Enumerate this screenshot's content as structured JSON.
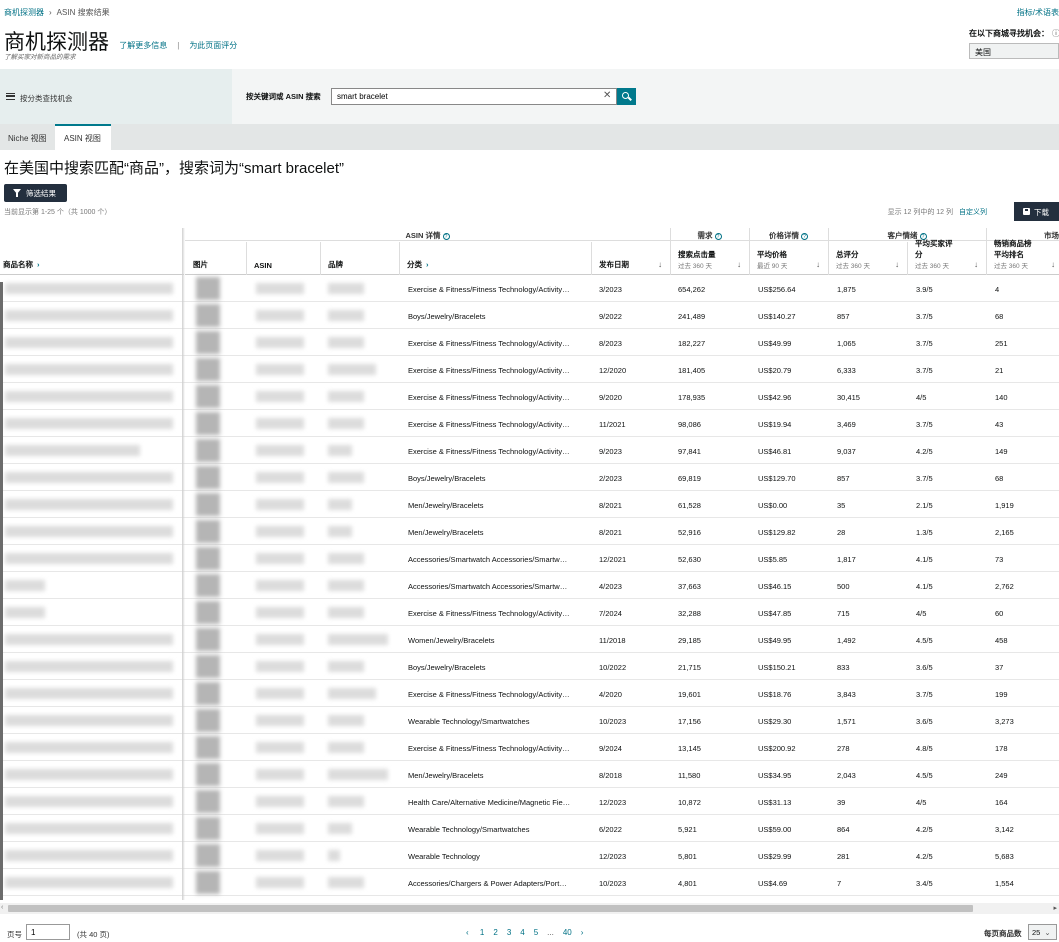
{
  "breadcrumb": {
    "root": "商机探测器",
    "current": "ASIN 搜索结果"
  },
  "top_right_link": "指标/术语表",
  "header": {
    "title": "商机探测器",
    "learn_more": "了解更多信息",
    "rate_page": "为此页面评分",
    "subtitle": "了解买家对新商品的需求"
  },
  "market": {
    "label": "在以下商城寻找机会：",
    "help_icon": "help-icon",
    "value": "美国"
  },
  "search": {
    "left_label": "按分类查找机会",
    "keyword_label": "按关键词或 ASIN 搜索",
    "value": "smart bracelet",
    "clear_icon": "close-icon",
    "button_icon": "search-icon"
  },
  "tabs": [
    {
      "label": "Niche 视图"
    },
    {
      "label": "ASIN 视图"
    }
  ],
  "result_heading": "在美国中搜索匹配“商品”，搜索词为“smart bracelet”",
  "filter_button": "筛选结果",
  "showing": "当前显示第 1-25 个（共 1000 个）",
  "columns_info": "显示 12 列中的 12 列",
  "customize_columns": "自定义列",
  "download_button": "下载",
  "table": {
    "groups": {
      "asin_details": "ASIN 详情",
      "demand": "需求",
      "price": "价格详情",
      "customer": "客户情绪",
      "market": "市场"
    },
    "columns": {
      "product_name": "商品名称",
      "image": "图片",
      "asin": "ASIN",
      "brand": "品牌",
      "category": "分类",
      "launch_date": "发布日期",
      "search_clicks": "搜索点击量",
      "search_clicks_sub": "过去 360 天",
      "avg_price": "平均价格",
      "avg_price_sub": "最近 90 天",
      "total_ratings": "总评分",
      "total_ratings_sub": "过去 360 天",
      "avg_rating_l1": "平均买家评",
      "avg_rating_l2": "分",
      "avg_rating_sub": "过去 360 天",
      "bsr_l1": "畅销商品榜",
      "bsr_l2": "平均排名",
      "bsr_sub": "过去 360 天"
    },
    "rows": [
      {
        "category": "Exercise & Fitness/Fitness Technology/Activity…",
        "date": "3/2023",
        "clicks": "654,262",
        "price": "US$256.64",
        "ratings": "1,875",
        "rating": "3.9/5",
        "bsr": "4"
      },
      {
        "category": "Boys/Jewelry/Bracelets",
        "date": "9/2022",
        "clicks": "241,489",
        "price": "US$140.27",
        "ratings": "857",
        "rating": "3.7/5",
        "bsr": "68"
      },
      {
        "category": "Exercise & Fitness/Fitness Technology/Activity…",
        "date": "8/2023",
        "clicks": "182,227",
        "price": "US$49.99",
        "ratings": "1,065",
        "rating": "3.7/5",
        "bsr": "251"
      },
      {
        "category": "Exercise & Fitness/Fitness Technology/Activity…",
        "date": "12/2020",
        "clicks": "181,405",
        "price": "US$20.79",
        "ratings": "6,333",
        "rating": "3.7/5",
        "bsr": "21"
      },
      {
        "category": "Exercise & Fitness/Fitness Technology/Activity…",
        "date": "9/2020",
        "clicks": "178,935",
        "price": "US$42.96",
        "ratings": "30,415",
        "rating": "4/5",
        "bsr": "140"
      },
      {
        "category": "Exercise & Fitness/Fitness Technology/Activity…",
        "date": "11/2021",
        "clicks": "98,086",
        "price": "US$19.94",
        "ratings": "3,469",
        "rating": "3.7/5",
        "bsr": "43"
      },
      {
        "category": "Exercise & Fitness/Fitness Technology/Activity…",
        "date": "9/2023",
        "clicks": "97,841",
        "price": "US$46.81",
        "ratings": "9,037",
        "rating": "4.2/5",
        "bsr": "149"
      },
      {
        "category": "Boys/Jewelry/Bracelets",
        "date": "2/2023",
        "clicks": "69,819",
        "price": "US$129.70",
        "ratings": "857",
        "rating": "3.7/5",
        "bsr": "68"
      },
      {
        "category": "Men/Jewelry/Bracelets",
        "date": "8/2021",
        "clicks": "61,528",
        "price": "US$0.00",
        "ratings": "35",
        "rating": "2.1/5",
        "bsr": "1,919"
      },
      {
        "category": "Men/Jewelry/Bracelets",
        "date": "8/2021",
        "clicks": "52,916",
        "price": "US$129.82",
        "ratings": "28",
        "rating": "1.3/5",
        "bsr": "2,165"
      },
      {
        "category": "Accessories/Smartwatch Accessories/Smartw…",
        "date": "12/2021",
        "clicks": "52,630",
        "price": "US$5.85",
        "ratings": "1,817",
        "rating": "4.1/5",
        "bsr": "73"
      },
      {
        "category": "Accessories/Smartwatch Accessories/Smartw…",
        "date": "4/2023",
        "clicks": "37,663",
        "price": "US$46.15",
        "ratings": "500",
        "rating": "4.1/5",
        "bsr": "2,762"
      },
      {
        "category": "Exercise & Fitness/Fitness Technology/Activity…",
        "date": "7/2024",
        "clicks": "32,288",
        "price": "US$47.85",
        "ratings": "715",
        "rating": "4/5",
        "bsr": "60"
      },
      {
        "category": "Women/Jewelry/Bracelets",
        "date": "11/2018",
        "clicks": "29,185",
        "price": "US$49.95",
        "ratings": "1,492",
        "rating": "4.5/5",
        "bsr": "458"
      },
      {
        "category": "Boys/Jewelry/Bracelets",
        "date": "10/2022",
        "clicks": "21,715",
        "price": "US$150.21",
        "ratings": "833",
        "rating": "3.6/5",
        "bsr": "37"
      },
      {
        "category": "Exercise & Fitness/Fitness Technology/Activity…",
        "date": "4/2020",
        "clicks": "19,601",
        "price": "US$18.76",
        "ratings": "3,843",
        "rating": "3.7/5",
        "bsr": "199"
      },
      {
        "category": "Wearable Technology/Smartwatches",
        "date": "10/2023",
        "clicks": "17,156",
        "price": "US$29.30",
        "ratings": "1,571",
        "rating": "3.6/5",
        "bsr": "3,273"
      },
      {
        "category": "Exercise & Fitness/Fitness Technology/Activity…",
        "date": "9/2024",
        "clicks": "13,145",
        "price": "US$200.92",
        "ratings": "278",
        "rating": "4.8/5",
        "bsr": "178"
      },
      {
        "category": "Men/Jewelry/Bracelets",
        "date": "8/2018",
        "clicks": "11,580",
        "price": "US$34.95",
        "ratings": "2,043",
        "rating": "4.5/5",
        "bsr": "249"
      },
      {
        "category": "Health Care/Alternative Medicine/Magnetic Fie…",
        "date": "12/2023",
        "clicks": "10,872",
        "price": "US$31.13",
        "ratings": "39",
        "rating": "4/5",
        "bsr": "164"
      },
      {
        "category": "Wearable Technology/Smartwatches",
        "date": "6/2022",
        "clicks": "5,921",
        "price": "US$59.00",
        "ratings": "864",
        "rating": "4.2/5",
        "bsr": "3,142"
      },
      {
        "category": "Wearable Technology",
        "date": "12/2023",
        "clicks": "5,801",
        "price": "US$29.99",
        "ratings": "281",
        "rating": "4.2/5",
        "bsr": "5,683"
      },
      {
        "category": "Accessories/Chargers & Power Adapters/Port…",
        "date": "10/2023",
        "clicks": "4,801",
        "price": "US$4.69",
        "ratings": "7",
        "rating": "3.4/5",
        "bsr": "1,554"
      }
    ]
  },
  "pagination": {
    "page_label": "页号",
    "page_value": "1",
    "total": "(共 40 页)",
    "pages": [
      "1",
      "2",
      "3",
      "4",
      "5",
      "...",
      "40"
    ],
    "per_page_label": "每页商品数",
    "per_page_value": "25"
  }
}
